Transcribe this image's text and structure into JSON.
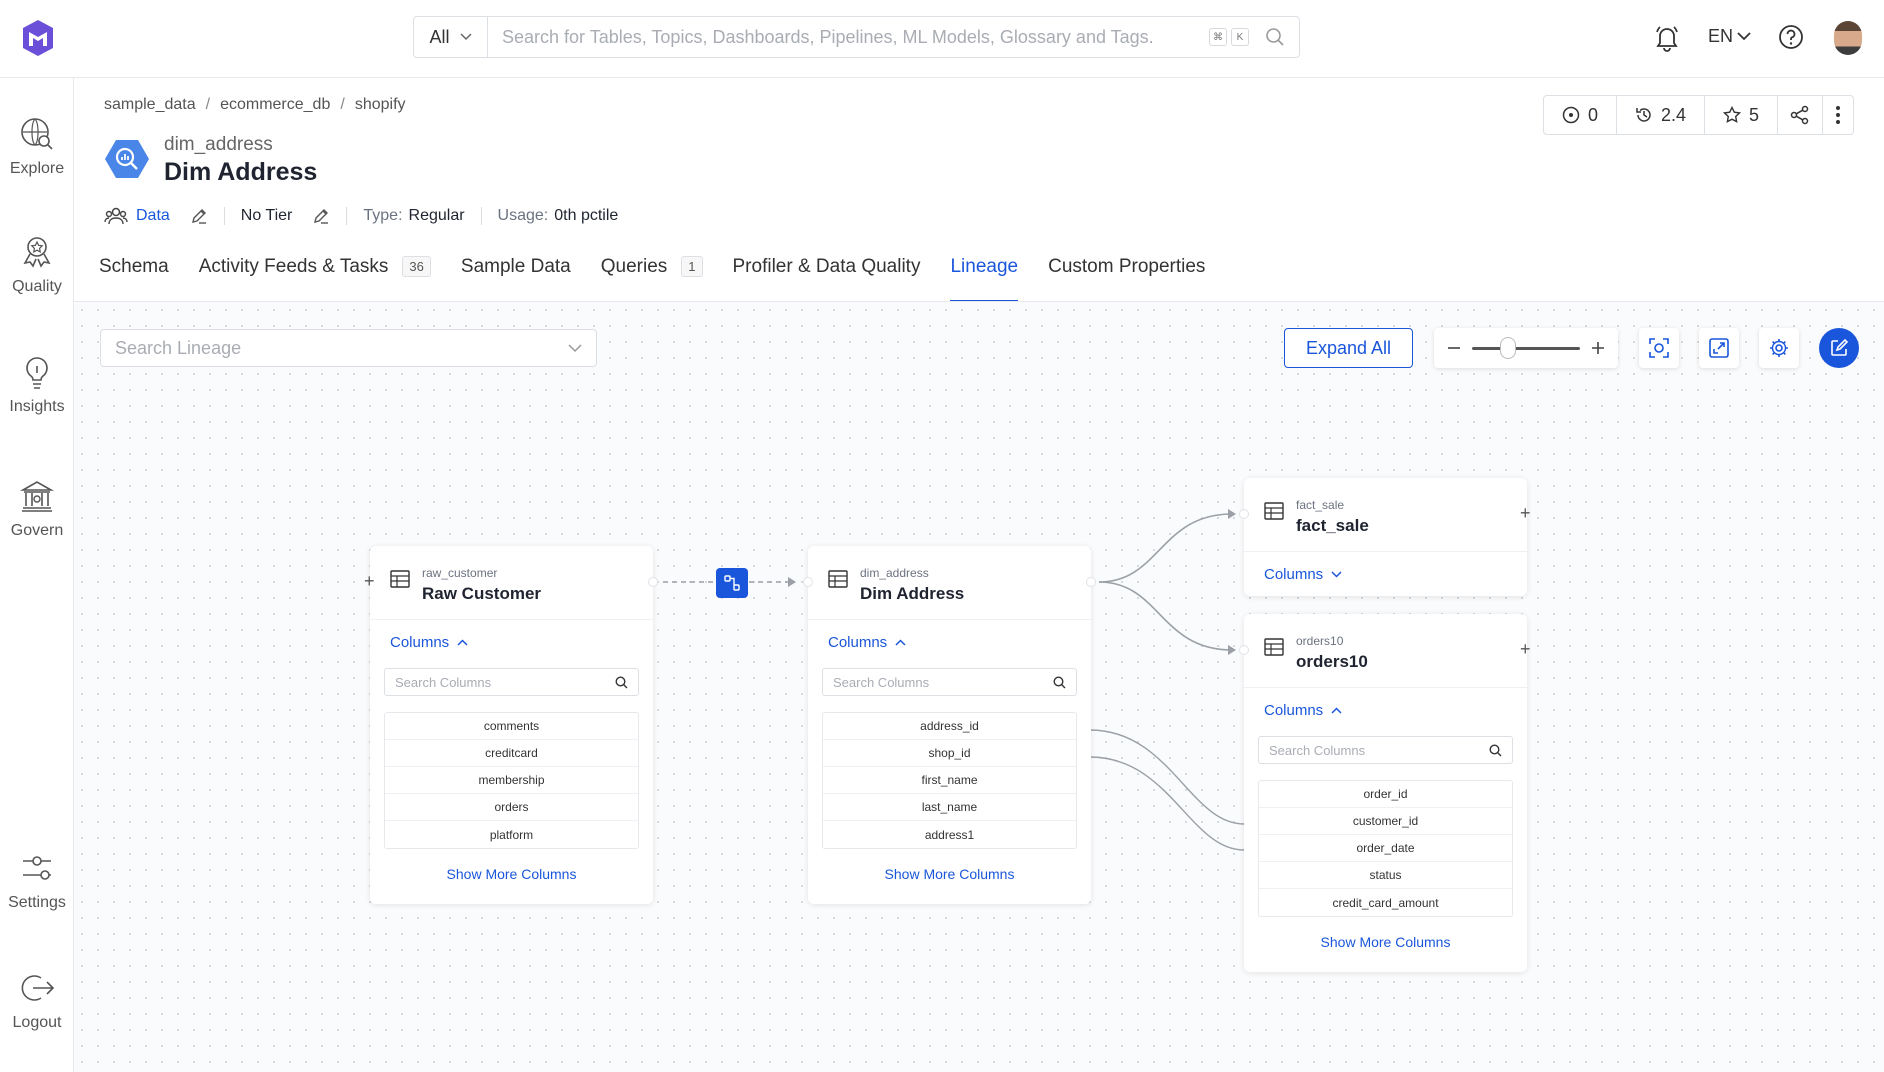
{
  "top": {
    "search_scope": "All",
    "search_placeholder": "Search for Tables, Topics, Dashboards, Pipelines, ML Models, Glossary and Tags.",
    "kbd_cmd": "⌘",
    "kbd_k": "K",
    "language": "EN"
  },
  "nav": {
    "explore": "Explore",
    "quality": "Quality",
    "insights": "Insights",
    "govern": "Govern",
    "settings": "Settings",
    "logout": "Logout"
  },
  "breadcrumb": [
    "sample_data",
    "ecommerce_db",
    "shopify"
  ],
  "entity": {
    "fqn": "dim_address",
    "name": "Dim Address",
    "owner": "Data",
    "tier": "No Tier",
    "type_label": "Type:",
    "type_value": "Regular",
    "usage_label": "Usage:",
    "usage_value": "0th pctile"
  },
  "stats": {
    "tasks": "0",
    "version": "2.4",
    "stars": "5"
  },
  "tabs": [
    {
      "label": "Schema",
      "count": ""
    },
    {
      "label": "Activity Feeds & Tasks",
      "count": "36"
    },
    {
      "label": "Sample Data",
      "count": ""
    },
    {
      "label": "Queries",
      "count": "1"
    },
    {
      "label": "Profiler & Data Quality",
      "count": ""
    },
    {
      "label": "Lineage",
      "count": ""
    },
    {
      "label": "Custom Properties",
      "count": ""
    }
  ],
  "lineage": {
    "search_placeholder": "Search Lineage",
    "expand_all": "Expand All",
    "columns_label": "Columns",
    "search_columns_placeholder": "Search Columns",
    "show_more": "Show More Columns",
    "nodes": {
      "raw_customer": {
        "fqn": "raw_customer",
        "name": "Raw Customer",
        "columns": [
          "comments",
          "creditcard",
          "membership",
          "orders",
          "platform"
        ]
      },
      "dim_address": {
        "fqn": "dim_address",
        "name": "Dim Address",
        "columns": [
          "address_id",
          "shop_id",
          "first_name",
          "last_name",
          "address1"
        ]
      },
      "fact_sale": {
        "fqn": "fact_sale",
        "name": "fact_sale",
        "columns": []
      },
      "orders10": {
        "fqn": "orders10",
        "name": "orders10",
        "columns": [
          "order_id",
          "customer_id",
          "order_date",
          "status",
          "credit_card_amount"
        ]
      }
    }
  },
  "colors": {
    "accent": "#1a56db",
    "border": "#dcdfe4",
    "canvas_bg": "#fafbfc"
  }
}
